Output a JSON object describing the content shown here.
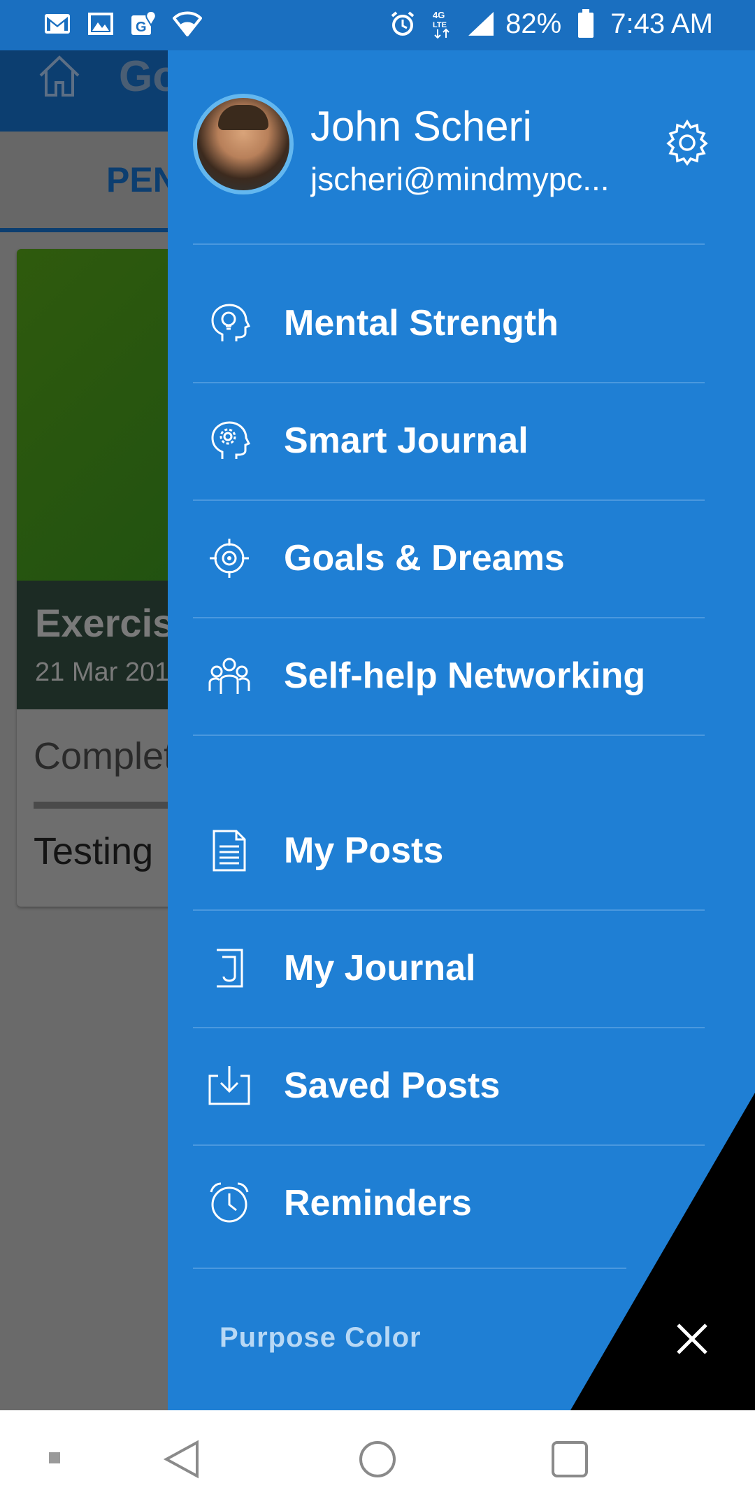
{
  "status_bar": {
    "battery": "82%",
    "time": "7:43 AM",
    "network": "4G LTE",
    "icons": [
      "gmail-icon",
      "gallery-icon",
      "maps-icon",
      "wifi-icon",
      "alarm-icon",
      "signal-icon",
      "battery-icon"
    ]
  },
  "background": {
    "header_title": "Go",
    "tab_label": "PEN",
    "card_title": "Exercis",
    "card_date": "21 Mar 201",
    "card_status": "Complet",
    "card_note": "Testing"
  },
  "drawer": {
    "user_name": "John Scheri",
    "user_email": "jscheri@mindmypc...",
    "menu_group_1": [
      {
        "label": "Mental Strength",
        "icon": "lightbulb-head-icon"
      },
      {
        "label": "Smart Journal",
        "icon": "gear-head-icon"
      },
      {
        "label": "Goals & Dreams",
        "icon": "target-icon"
      },
      {
        "label": "Self-help Networking",
        "icon": "people-group-icon"
      }
    ],
    "menu_group_2": [
      {
        "label": "My Posts",
        "icon": "document-icon"
      },
      {
        "label": "My Journal",
        "icon": "journal-icon"
      },
      {
        "label": "Saved Posts",
        "icon": "download-tray-icon"
      },
      {
        "label": "Reminders",
        "icon": "alarm-clock-icon"
      }
    ],
    "brand": "Purpose Color"
  },
  "colors": {
    "drawer_bg": "#1f7fd4",
    "status_bar": "#1a6fc0",
    "header_dark": "#0c3e70"
  }
}
